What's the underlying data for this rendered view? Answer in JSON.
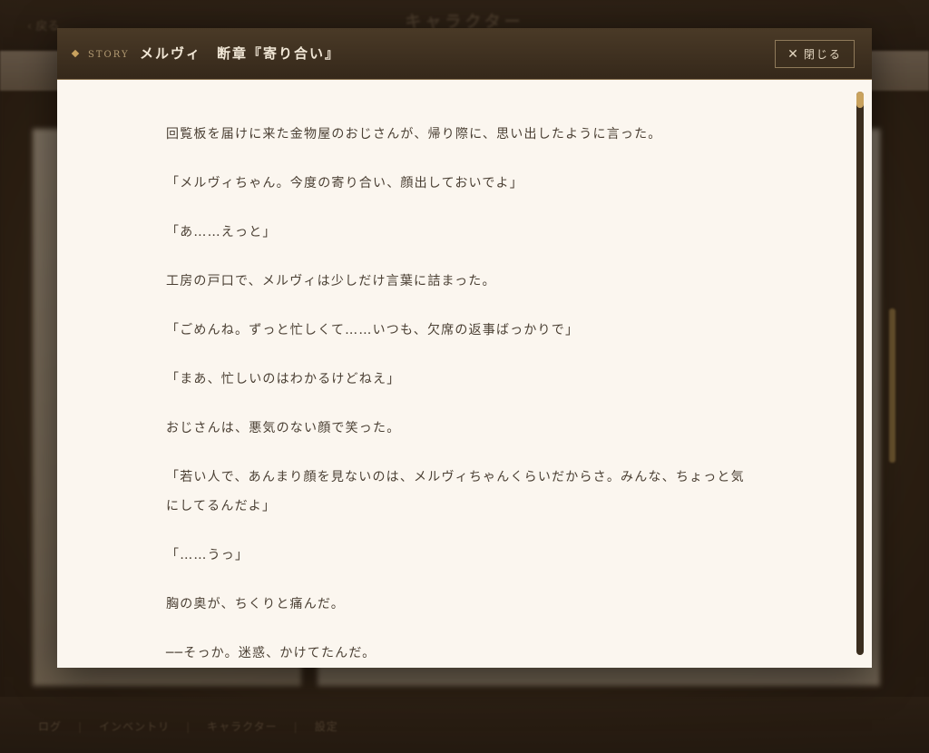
{
  "background": {
    "back_label": "戻る",
    "screen_title": "キャラクター",
    "nav_items": [
      "ログ",
      "インベントリ",
      "キャラクター",
      "設定"
    ]
  },
  "modal": {
    "tag": "STORY",
    "title": "メルヴィ　断章『寄り合い』",
    "close_label": "閉じる",
    "lines": [
      "回覧板を届けに来た金物屋のおじさんが、帰り際に、思い出したように言った。",
      "「メルヴィちゃん。今度の寄り合い、顔出しておいでよ」",
      "「あ……えっと」",
      "工房の戸口で、メルヴィは少しだけ言葉に詰まった。",
      "「ごめんね。ずっと忙しくて……いつも、欠席の返事ばっかりで」",
      "「まあ、忙しいのはわかるけどねえ」",
      "おじさんは、悪気のない顔で笑った。",
      "「若い人で、あんまり顔を見ないのは、メルヴィちゃんくらいだからさ。みんな、ちょっと気にしてるんだよ」",
      "「……うっ」",
      "胸の奥が、ちくりと痛んだ。",
      "──そっか。迷惑、かけてたんだ。"
    ]
  },
  "colors": {
    "accent_gold": "#c9a25e",
    "header_bg": "#3f3020",
    "paper": "#fbf6ef",
    "text": "#4a3f33"
  }
}
